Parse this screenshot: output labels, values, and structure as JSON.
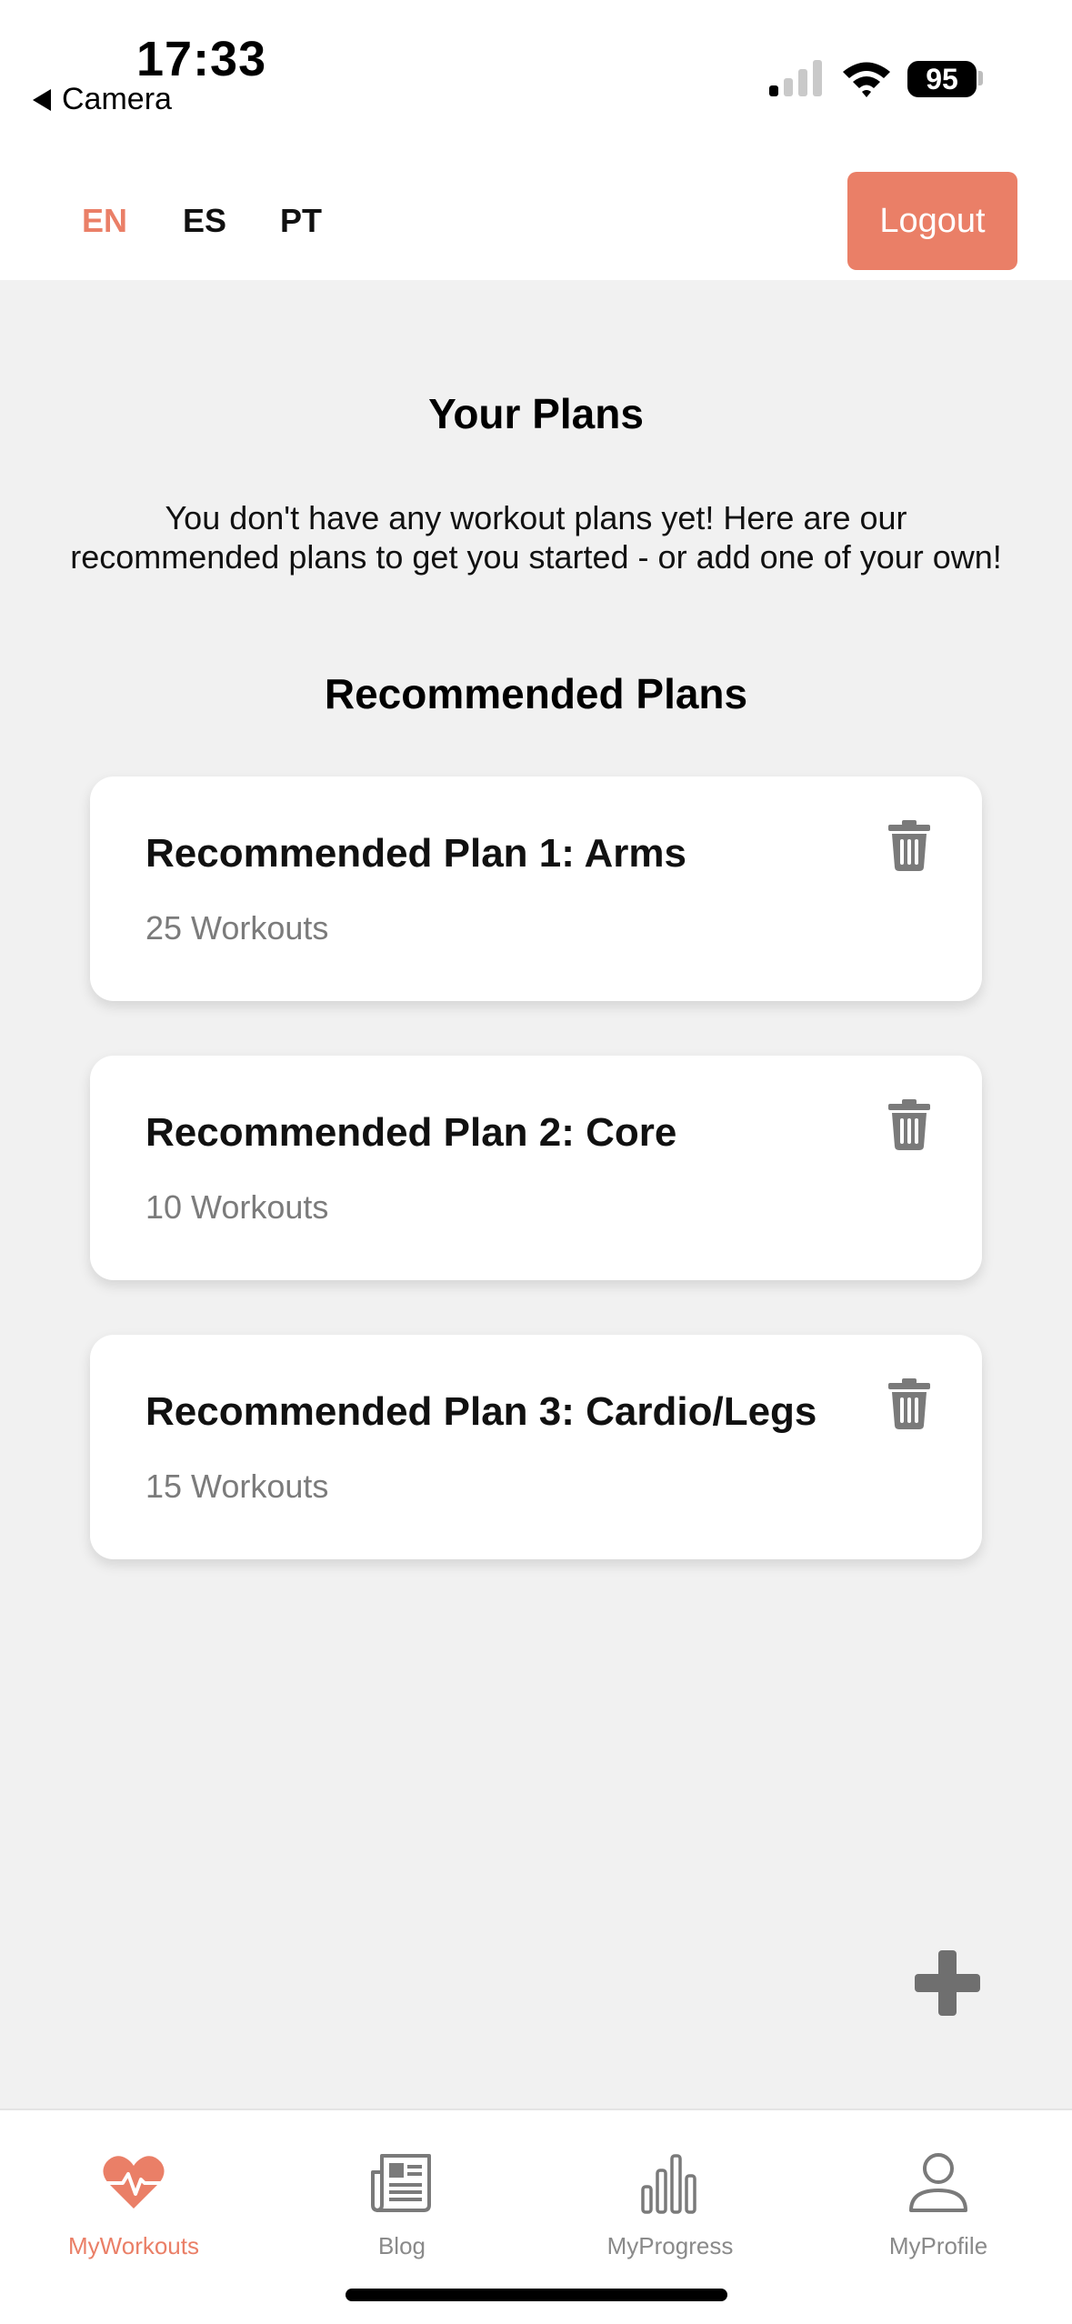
{
  "status_bar": {
    "time": "17:33",
    "back_label": "Camera",
    "battery": "95"
  },
  "top_nav": {
    "languages": [
      "EN",
      "ES",
      "PT"
    ],
    "active_language": "EN",
    "logout_label": "Logout"
  },
  "main": {
    "title": "Your Plans",
    "intro": "You don't have any workout plans yet! Here are our recommended plans to get you started - or add one of your own!",
    "section_title": "Recommended Plans",
    "plans": [
      {
        "name": "Recommended Plan 1: Arms",
        "count": "25 Workouts"
      },
      {
        "name": "Recommended Plan 2: Core",
        "count": "10 Workouts"
      },
      {
        "name": "Recommended Plan 3: Cardio/Legs",
        "count": "15 Workouts"
      }
    ]
  },
  "tab_bar": {
    "tabs": [
      {
        "label": "MyWorkouts",
        "icon": "heart-pulse-icon"
      },
      {
        "label": "Blog",
        "icon": "newspaper-icon"
      },
      {
        "label": "MyProgress",
        "icon": "bar-chart-icon"
      },
      {
        "label": "MyProfile",
        "icon": "person-icon"
      }
    ],
    "active_tab": "MyWorkouts"
  },
  "colors": {
    "accent": "#ea7f67",
    "background": "#f1f1f1",
    "icon_gray": "#7a7a7a"
  }
}
